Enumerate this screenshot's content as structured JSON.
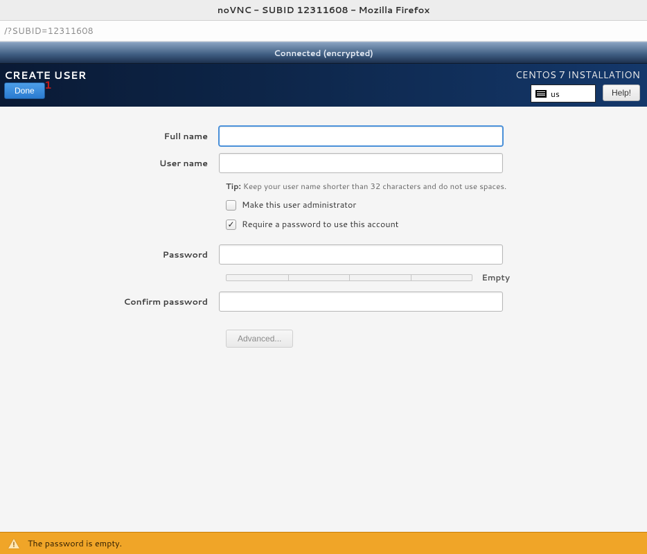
{
  "window": {
    "title": "noVNC - SUBID 12311608 - Mozilla Firefox",
    "url": "/?SUBID=12311608"
  },
  "vnc_status": "Connected (encrypted)",
  "header": {
    "page_title": "CREATE USER",
    "installer_title": "CENTOS 7 INSTALLATION",
    "done_label": "Done",
    "done_annotation": "1",
    "keyboard_layout": "us",
    "help_label": "Help!"
  },
  "form": {
    "fullname_label": "Full name",
    "fullname_value": "",
    "username_label": "User name",
    "username_value": "",
    "tip_prefix": "Tip:",
    "tip_text": " Keep your user name shorter than 32 characters and do not use spaces.",
    "admin_checkbox_label": "Make this user administrator",
    "admin_checked": false,
    "require_pw_label": "Require a password to use this account",
    "require_pw_checked": true,
    "password_label": "Password",
    "password_value": "",
    "strength_text": "Empty",
    "confirm_label": "Confirm password",
    "confirm_value": "",
    "advanced_label": "Advanced..."
  },
  "warning": {
    "message": "The password is empty."
  }
}
